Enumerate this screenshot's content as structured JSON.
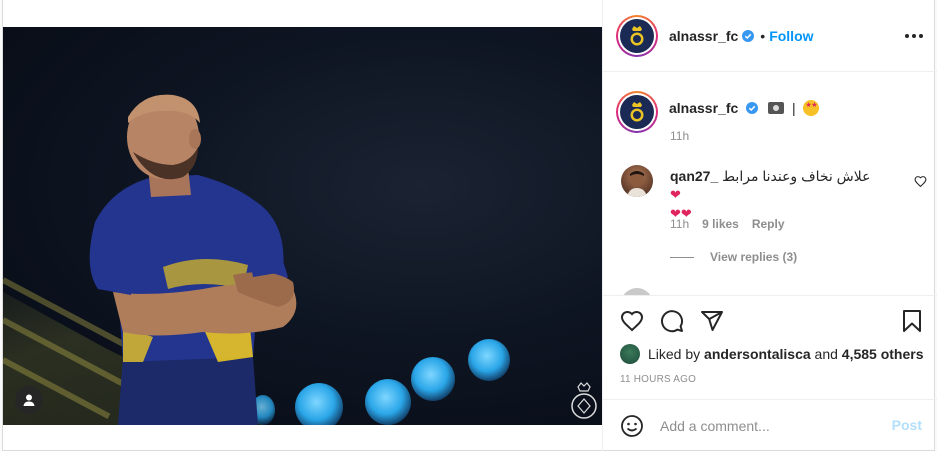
{
  "post": {
    "author": "alnassr_fc",
    "follow_label": "Follow",
    "dot": "•",
    "caption_separator": "|",
    "caption_time": "11h"
  },
  "comment": {
    "username": "qan27_",
    "text": "علاش نخاف وعندنا مرابط",
    "time": "11h",
    "likes": "9 likes",
    "reply_label": "Reply",
    "view_replies": "View replies (3)"
  },
  "likes": {
    "prefix": "Liked by",
    "user": "andersontalisca",
    "conjunction": "and",
    "others": "4,585 others"
  },
  "timestamp": "11 HOURS AGO",
  "add_comment": {
    "placeholder": "Add a comment...",
    "post_label": "Post"
  },
  "colors": {
    "link_blue": "#0095f6",
    "post_disabled": "#b2dffc",
    "heart_red": "#e0245e"
  },
  "icons": {
    "like": "heart-outline",
    "comment": "speech-bubble",
    "share": "paper-plane",
    "save": "bookmark",
    "tag": "user-silhouette",
    "emoji": "smiley"
  }
}
